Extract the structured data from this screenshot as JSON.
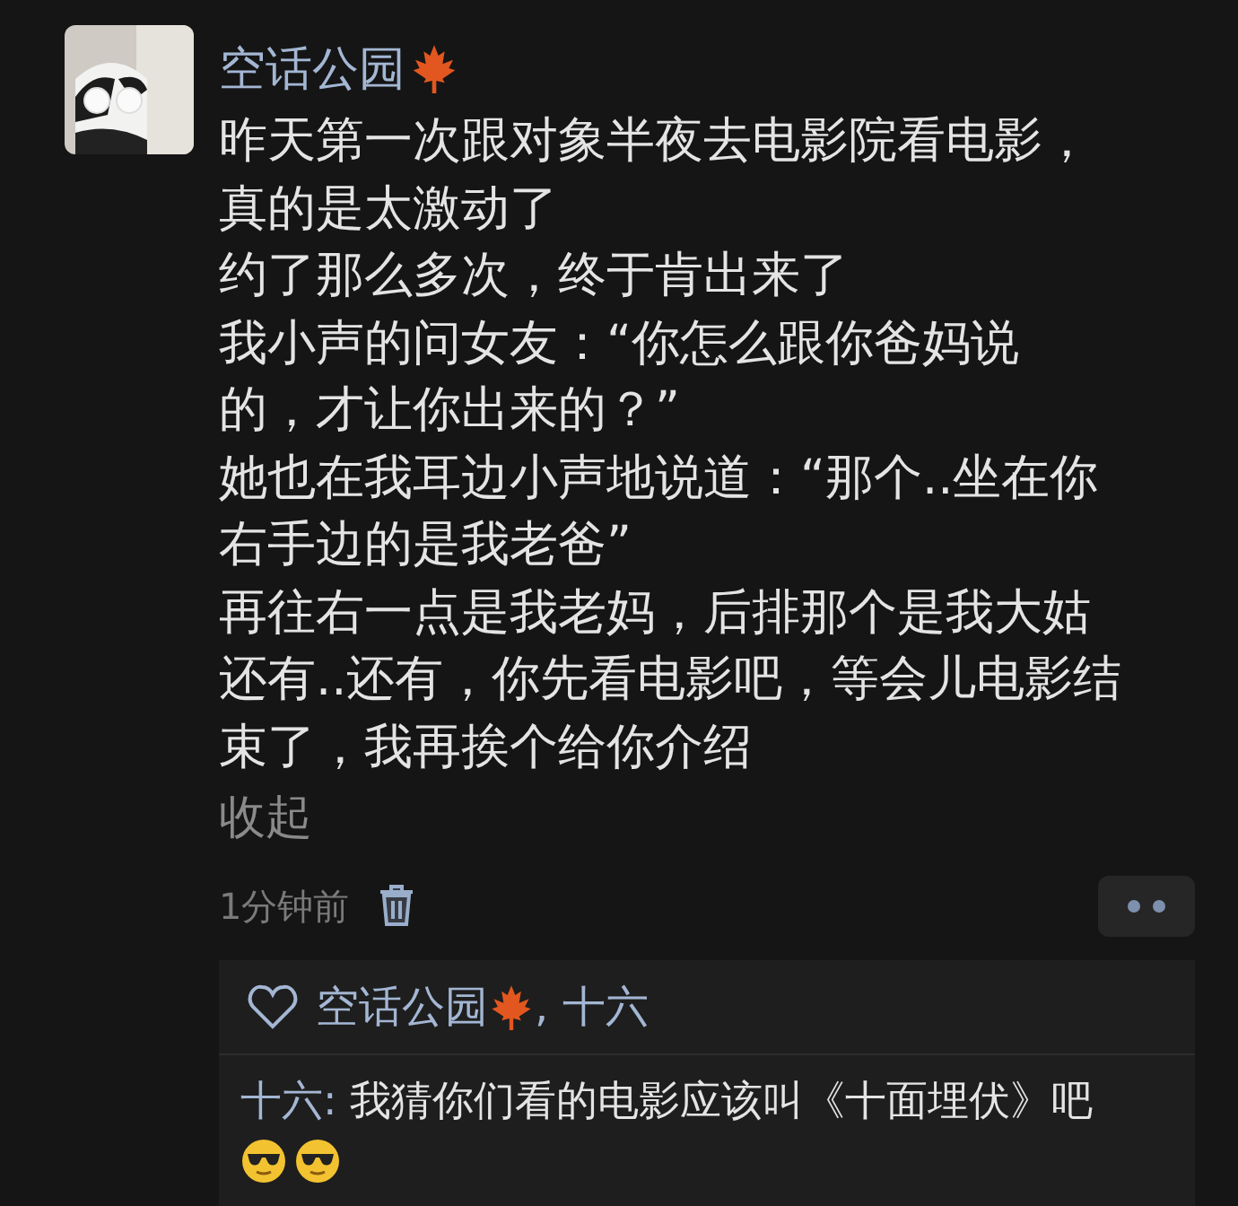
{
  "comment": {
    "author": "空话公园",
    "lines": [
      "昨天第一次跟对象半夜去电影院看电影，",
      "真的是太激动了",
      "约了那么多次，终于肯出来了",
      "我小声的问女友：“你怎么跟你爸妈说",
      "的，才让你出来的？”",
      "她也在我耳边小声地说道：“那个..坐在你",
      "右手边的是我老爸”",
      "再往右一点是我老妈，后排那个是我大姑",
      "还有..还有，你先看电影吧，等会儿电影结",
      "束了，我再挨个给你介绍"
    ],
    "collapse_link": "收起",
    "time": "1分钟前"
  },
  "likes": {
    "separator": ", ",
    "likers": [
      {
        "name": "空话公园",
        "badge": true
      },
      {
        "name": "十六",
        "badge": false
      }
    ]
  },
  "reply": {
    "author": "十六:",
    "text": "我猜你们看的电影应该叫《十面埋伏》吧"
  }
}
